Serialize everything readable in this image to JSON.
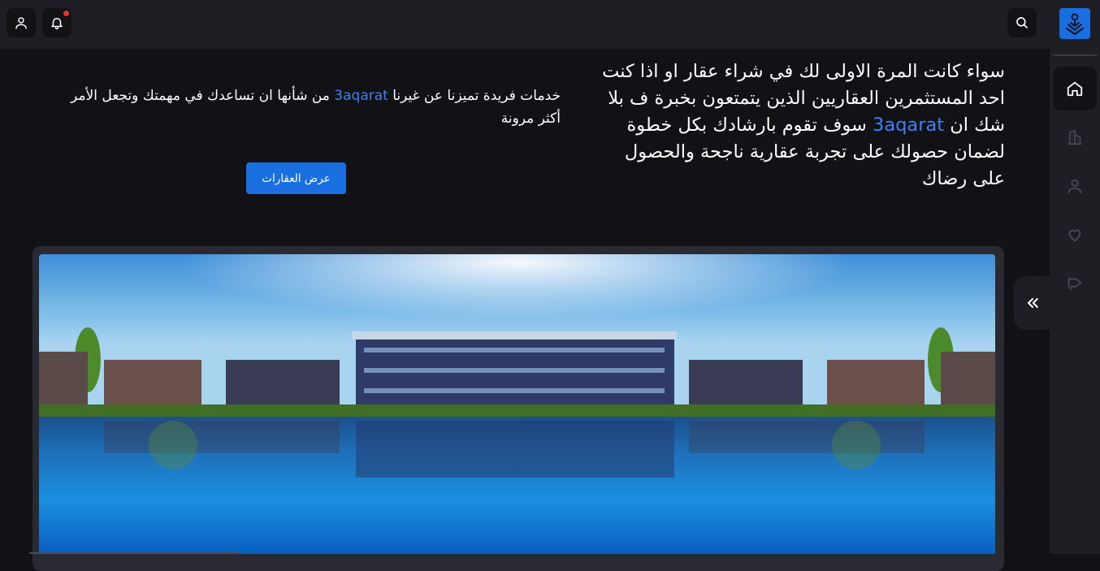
{
  "header": {
    "user_icon": "user-icon",
    "notification_icon": "bell-icon",
    "search_icon": "search-icon",
    "notification_dot_color": "#e8332f"
  },
  "sidebar": {
    "logo_icon": "app-logo",
    "items": [
      {
        "id": "home",
        "icon": "home-icon",
        "active": true
      },
      {
        "id": "buildings",
        "icon": "buildings-icon",
        "active": false
      },
      {
        "id": "profile",
        "icon": "user-icon",
        "active": false
      },
      {
        "id": "favorites",
        "icon": "heart-icon",
        "active": false
      },
      {
        "id": "promotions",
        "icon": "megaphone-icon",
        "active": false
      }
    ],
    "collapse_icon": "chevrons-left-icon"
  },
  "hero": {
    "right_text_before": "سواء كانت المرة الاولى لك في شراء عقار او اذا كنت احد المستثمرين العقاريين الذين يتمتعون بخبرة ف بلا شك ان ",
    "right_brand": "3aqarat",
    "right_text_after": " سوف تقوم بارشادك بكل خطوة لضمان حصولك على تجربة عقارية ناجحة والحصول على رضاك",
    "left_text_before": "خدمات فريدة تميزنا عن غيرنا ",
    "left_brand": "3aqarat",
    "left_text_after": " من شأنها ان تساعدك في مهمتك وتجعل الأمر أكثر مرونة",
    "cta_label": "عرض العقارات"
  },
  "colors": {
    "accent": "#1a6fe0",
    "brand_text": "#3b82f6",
    "background": "#121216",
    "surface": "#1f1e24"
  }
}
